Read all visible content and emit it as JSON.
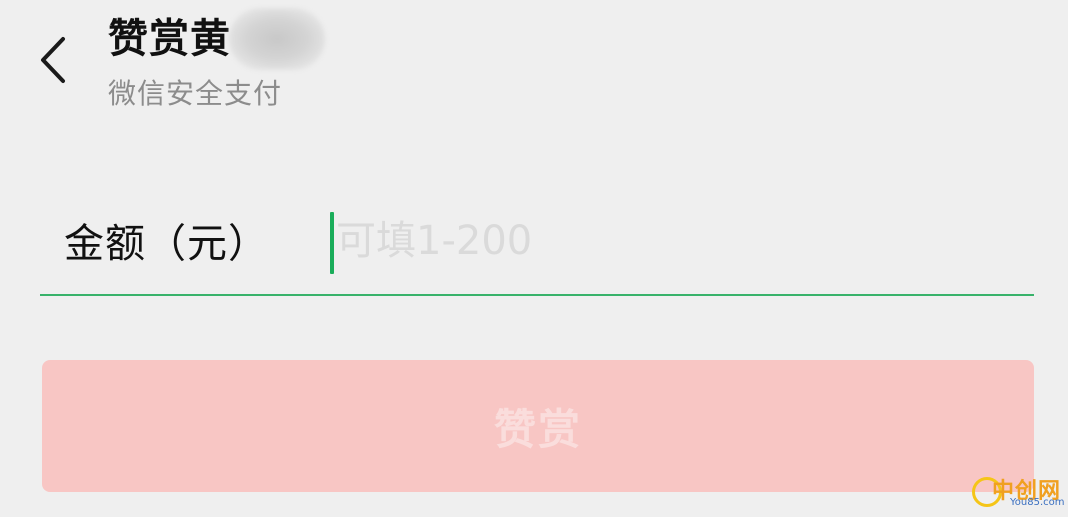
{
  "header": {
    "title": "赞赏黄",
    "subtitle": "微信安全支付",
    "back_icon": "chevron-left-icon"
  },
  "amount": {
    "label": "金额（元）",
    "placeholder": "可填1-200",
    "value": ""
  },
  "reward_button": {
    "label": "赞赏",
    "background": "#f8c6c4",
    "text_color": "#fadddc",
    "enabled": false
  },
  "colors": {
    "accent": "#1aad5a",
    "underline": "#38b26a",
    "page_background": "#efefef"
  },
  "watermark": {
    "text": "中创网",
    "url": "You85.com"
  }
}
